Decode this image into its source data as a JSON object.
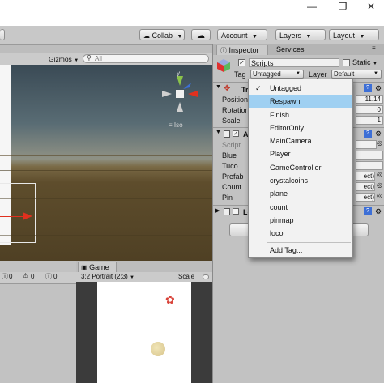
{
  "window": {
    "minimize": "—",
    "maximize": "❐",
    "close": "✕"
  },
  "toolbar": {
    "collab": "Collab",
    "account": "Account",
    "layers": "Layers",
    "layout": "Layout"
  },
  "scene": {
    "gizmos": "Gizmos",
    "search_placeholder": "All",
    "view_label": "Iso"
  },
  "inspector": {
    "tab_inspector": "Inspector",
    "tab_services": "Services",
    "object_name": "Scripts",
    "static_label": "Static",
    "tag_label": "Tag",
    "tag_value": "Untagged",
    "layer_label": "Layer",
    "layer_value": "Default",
    "transform_title": "Tr",
    "position_label": "Position",
    "rotation_label": "Rotation",
    "scale_label": "Scale",
    "position_value": "11.14",
    "rotation_value": "0",
    "scale_value": "1",
    "script_component_title": "Al",
    "fields": [
      "Script",
      "Blue",
      "Tuco",
      "Prefab",
      "Count",
      "Pin"
    ],
    "field_values": [
      "",
      "",
      "",
      "ect)",
      "ect)",
      "ect)"
    ],
    "third_component_title": "Lo"
  },
  "tag_menu": {
    "items": [
      "Untagged",
      "Respawn",
      "Finish",
      "EditorOnly",
      "MainCamera",
      "Player",
      "GameController",
      "crystalcoins",
      "plane",
      "count",
      "pinmap",
      "loco"
    ],
    "checked": "Untagged",
    "highlighted": "Respawn",
    "add_tag": "Add Tag..."
  },
  "bottom": {
    "counts": [
      "0",
      "0",
      "0"
    ],
    "game_tab": "Game",
    "aspect": "3:2 Portrait (2:3)",
    "scale_label": "Scale"
  },
  "colors": {
    "highlight": "#9fd0f2",
    "axis_x": "#e0301e",
    "axis_y": "#8bc34a",
    "axis_z": "#3d6fd6"
  }
}
